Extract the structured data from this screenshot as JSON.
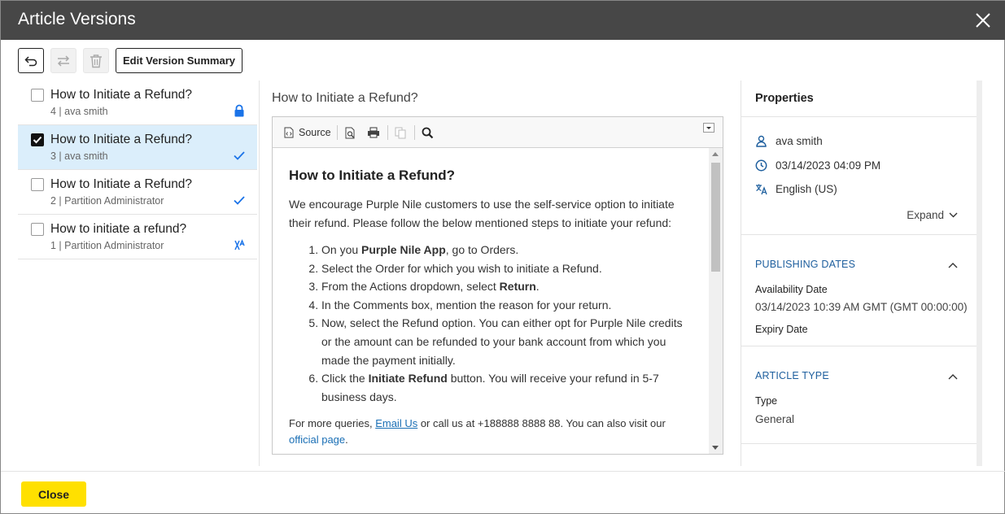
{
  "window": {
    "title": "Article Versions"
  },
  "toolbar": {
    "edit_summary_label": "Edit Version Summary"
  },
  "versions": [
    {
      "title": "How to Initiate a Refund?",
      "meta": "4 | ava smith",
      "checked": false,
      "status_icon": "lock-icon"
    },
    {
      "title": "How to Initiate a Refund?",
      "meta": "3 | ava smith",
      "checked": true,
      "status_icon": "check-icon"
    },
    {
      "title": "How to Initiate a Refund?",
      "meta": "2 | Partition Administrator",
      "checked": false,
      "status_icon": "check-icon"
    },
    {
      "title": "How to initiate a refund?",
      "meta": "1 | Partition Administrator",
      "checked": false,
      "status_icon": "translate-icon"
    }
  ],
  "center": {
    "title": "How to Initiate a Refund?",
    "editor_toolbar": {
      "source_label": "Source"
    },
    "doc": {
      "heading": "How to Initiate a Refund?",
      "intro": "We encourage Purple Nile customers to use the self-service option to initiate their refund. Please follow the below mentioned steps to initiate your refund:",
      "steps": [
        {
          "pre": " On you ",
          "bold": "Purple Nile App",
          "post": ", go to Orders."
        },
        {
          "pre": "Select the Order for which you wish to initiate a Refund.",
          "bold": "",
          "post": ""
        },
        {
          "pre": "From the Actions dropdown, select ",
          "bold": "Return",
          "post": "."
        },
        {
          "pre": "In the Comments box, mention the reason for your return.",
          "bold": "",
          "post": ""
        },
        {
          "pre": "Now, select the Refund option. You can either opt for Purple Nile credits or the amount can be refunded to your bank account from which you made the payment initially.",
          "bold": "",
          "post": ""
        },
        {
          "pre": "Click the ",
          "bold": "Initiate Refund",
          "post": " button. You will receive your refund in 5-7 business days."
        }
      ],
      "footer_pre": "For more queries, ",
      "footer_link1": "Email Us",
      "footer_mid": " or call us at +188888 8888 88. You can also visit our ",
      "footer_link2": "official page",
      "footer_post": "."
    }
  },
  "properties": {
    "title": "Properties",
    "author": "ava smith",
    "date": "03/14/2023 04:09 PM",
    "language": "English (US)",
    "expand_label": "Expand",
    "publishing": {
      "heading": "PUBLISHING DATES",
      "availability_label": "Availability Date",
      "availability_value": "03/14/2023 10:39 AM GMT (GMT 00:00:00)",
      "expiry_label": "Expiry Date"
    },
    "article_type": {
      "heading": "ARTICLE TYPE",
      "type_label": "Type",
      "type_value": "General"
    }
  },
  "footer": {
    "close_label": "Close"
  },
  "colors": {
    "header_bg": "#474747",
    "accent_blue": "#1a73e8",
    "selected_bg": "#dbeefb",
    "close_yellow": "#ffe000"
  }
}
